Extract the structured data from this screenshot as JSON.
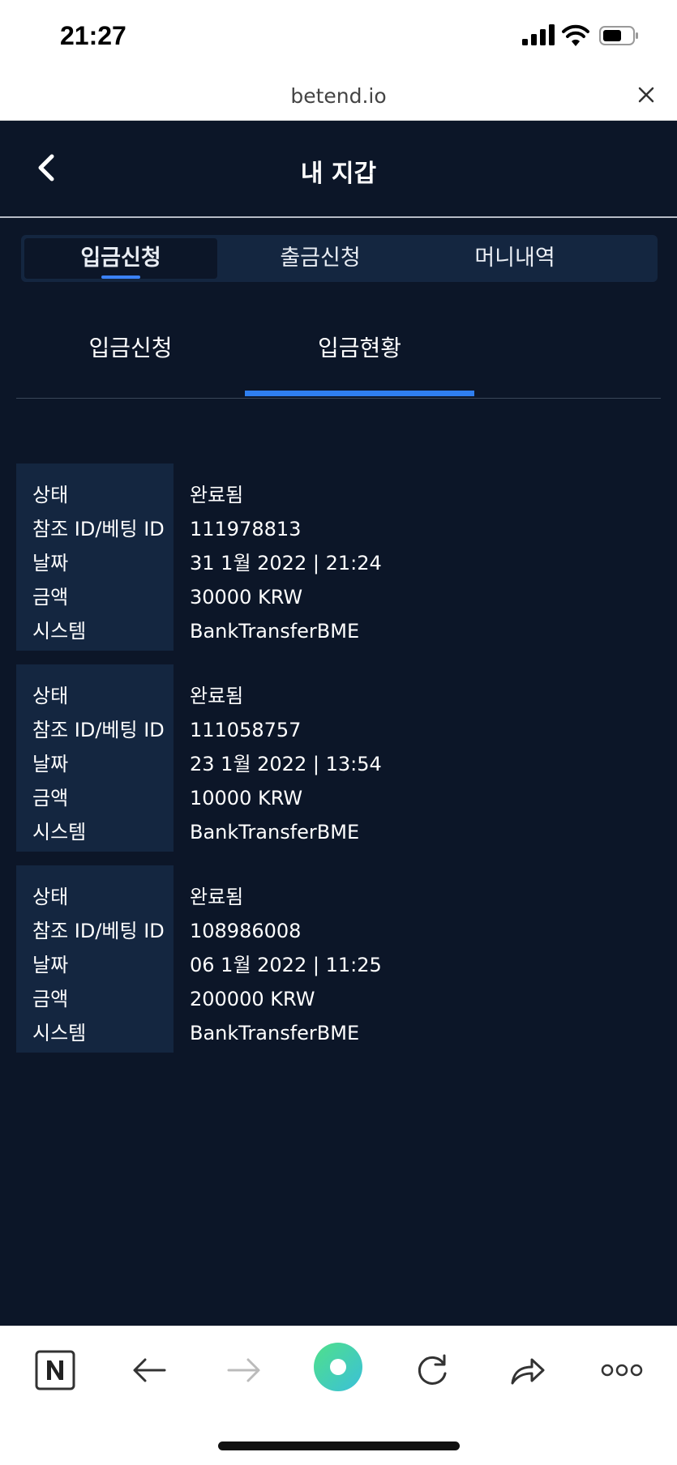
{
  "status_bar": {
    "time": "21:27"
  },
  "browser": {
    "url": "betend.io"
  },
  "header": {
    "title": "내 지갑"
  },
  "tabs": [
    {
      "label": "입금신청",
      "active": true
    },
    {
      "label": "출금신청",
      "active": false
    },
    {
      "label": "머니내역",
      "active": false
    }
  ],
  "subtabs": [
    {
      "label": "입금신청",
      "active": false
    },
    {
      "label": "입금현황",
      "active": true
    }
  ],
  "labels": {
    "status": "상태",
    "ref_id": "참조 ID/베팅 ID",
    "date": "날짜",
    "amount": "금액",
    "system": "시스템"
  },
  "deposits": [
    {
      "status": "완료됨",
      "ref_id": "111978813",
      "date": "31 1월 2022 | 21:24",
      "amount": "30000 KRW",
      "system": "BankTransferBME"
    },
    {
      "status": "완료됨",
      "ref_id": "111058757",
      "date": "23 1월 2022 | 13:54",
      "amount": "10000 KRW",
      "system": "BankTransferBME"
    },
    {
      "status": "완료됨",
      "ref_id": "108986008",
      "date": "06 1월 2022 | 11:25",
      "amount": "200000 KRW",
      "system": "BankTransferBME"
    }
  ],
  "colors": {
    "background": "#0c1628",
    "panel": "#142640",
    "accent": "#2f7ff0"
  },
  "bottom_toolbar": {
    "icons": [
      "naver-n-icon",
      "back-arrow-icon",
      "forward-arrow-icon",
      "green-dot-icon",
      "reload-icon",
      "share-icon",
      "more-icon"
    ]
  }
}
